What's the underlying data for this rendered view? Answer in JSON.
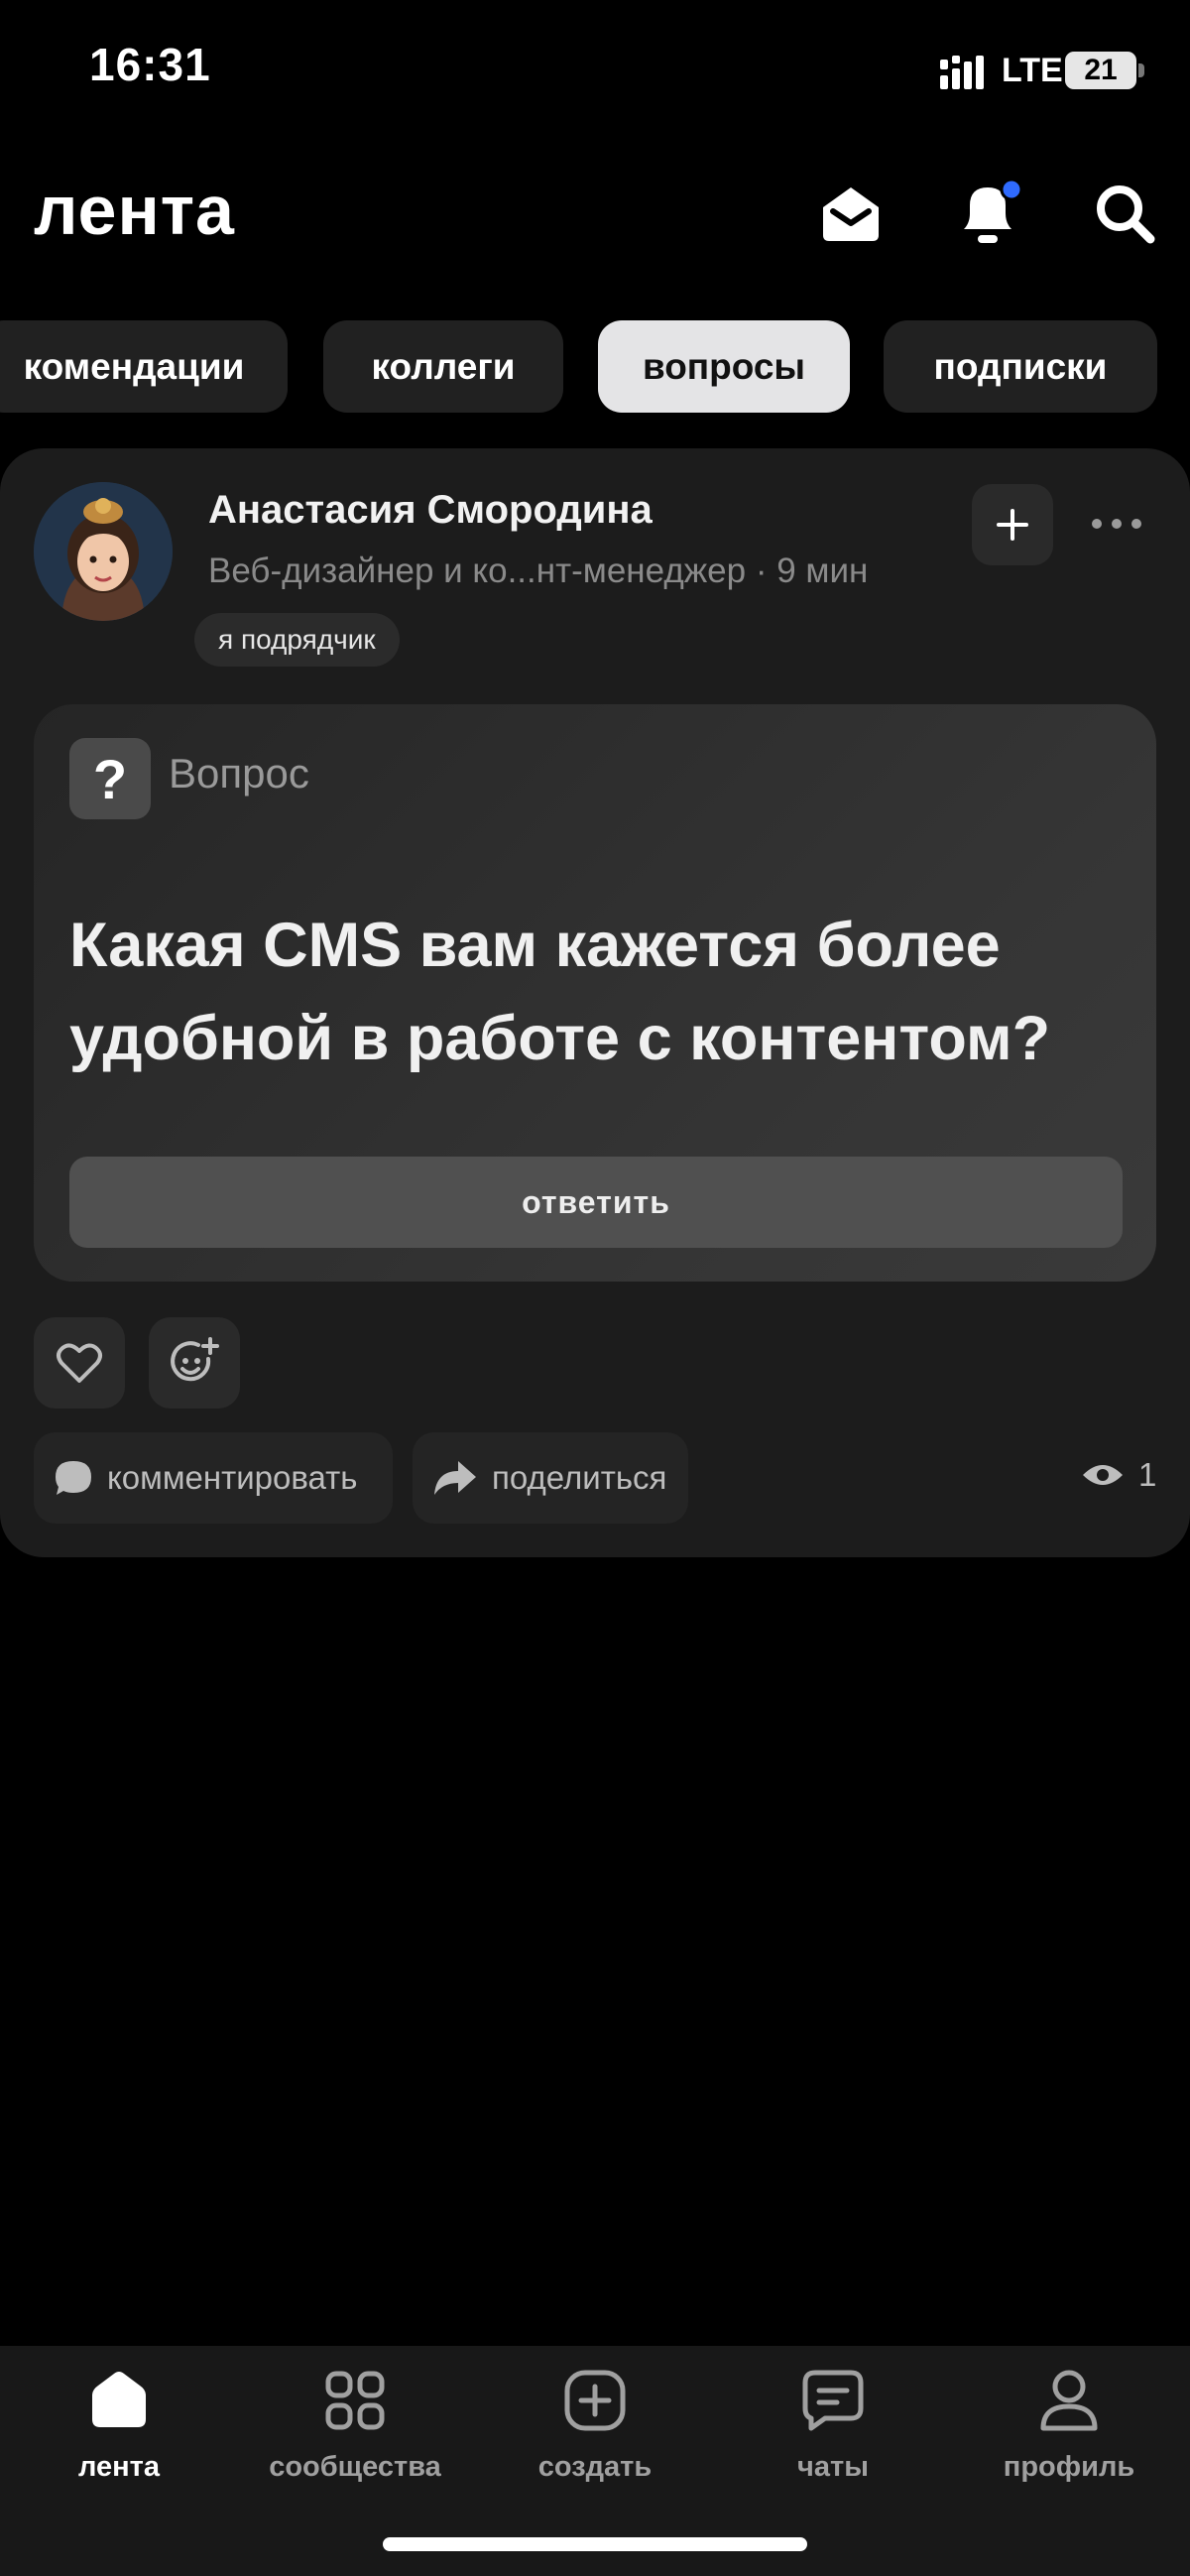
{
  "status": {
    "time": "16:31",
    "network": "LTE",
    "battery": "21"
  },
  "header": {
    "title": "лента"
  },
  "tabs": [
    {
      "label": "рекомендации",
      "shown": "комендации"
    },
    {
      "label": "коллеги"
    },
    {
      "label": "вопросы",
      "active": true
    },
    {
      "label": "подписки"
    }
  ],
  "post": {
    "author": "Анастасия Смородина",
    "role_time": "Веб-дизайнер и ко...нт-менеджер · 9 мин",
    "badge": "я подрядчик",
    "question_label": "Вопрос",
    "question": "Какая CMS вам кажется более удобной в работе с контентом?",
    "answer_label": "ответить",
    "comment_label": "комментировать",
    "share_label": "поделиться",
    "views": "1"
  },
  "nav": [
    {
      "label": "лента",
      "icon": "home-icon",
      "active": true
    },
    {
      "label": "сообщества",
      "icon": "grid-icon"
    },
    {
      "label": "создать",
      "icon": "plus-square-icon"
    },
    {
      "label": "чаты",
      "icon": "chat-icon"
    },
    {
      "label": "профиль",
      "icon": "profile-icon"
    }
  ],
  "colors": {
    "accent_dot": "#2f6bff",
    "background": "#000000",
    "card": "#1c1c1c"
  }
}
